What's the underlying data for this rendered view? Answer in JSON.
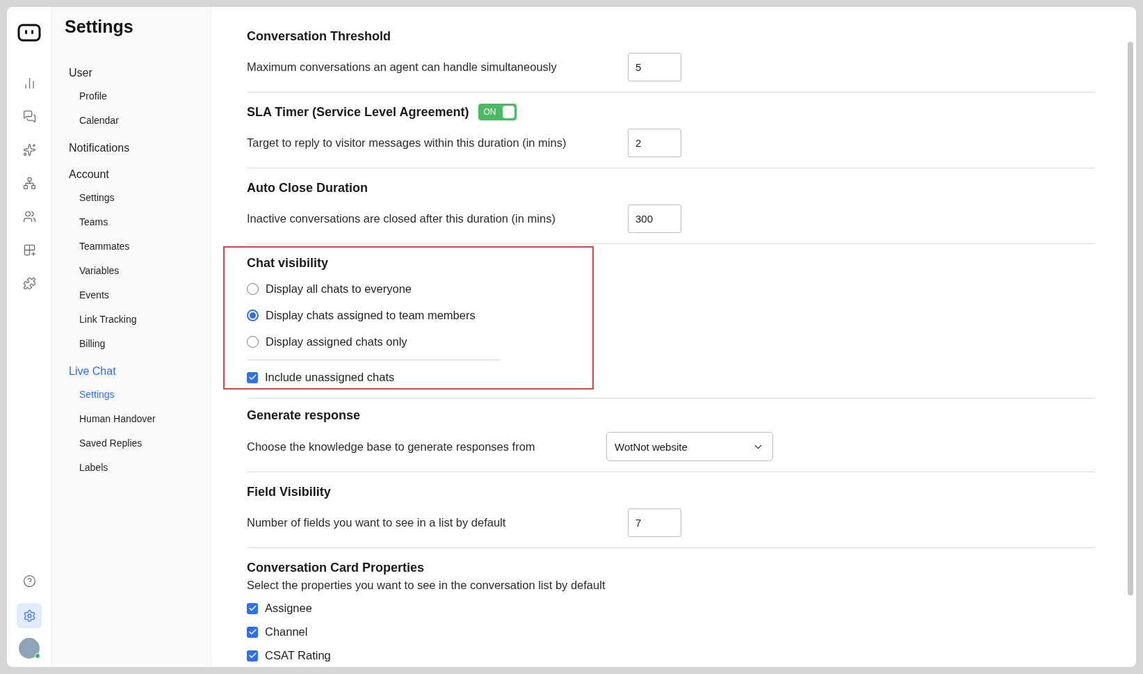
{
  "app": {
    "title": "Settings"
  },
  "rail": {
    "top": [
      {
        "kind": "chart",
        "selected": false
      },
      {
        "kind": "chat",
        "selected": false
      },
      {
        "kind": "sparkle",
        "selected": false
      },
      {
        "kind": "hierarchy",
        "selected": false
      },
      {
        "kind": "users",
        "selected": false
      },
      {
        "kind": "apps",
        "selected": false
      },
      {
        "kind": "puzzle",
        "selected": false
      }
    ],
    "bottom": [
      {
        "kind": "help",
        "selected": false
      },
      {
        "kind": "settings",
        "selected": true
      },
      {
        "kind": "avatar",
        "selected": false,
        "online": true
      }
    ]
  },
  "sidebar": {
    "groups": [
      {
        "label": "User",
        "selected": false,
        "children": [
          {
            "label": "Profile",
            "selected": false
          },
          {
            "label": "Calendar",
            "selected": false
          }
        ]
      },
      {
        "label": "Notifications",
        "selected": false
      },
      {
        "label": "Account",
        "selected": false,
        "children": [
          {
            "label": "Settings",
            "selected": false
          },
          {
            "label": "Teams",
            "selected": false
          },
          {
            "label": "Teammates",
            "selected": false
          },
          {
            "label": "Variables",
            "selected": false
          },
          {
            "label": "Events",
            "selected": false
          },
          {
            "label": "Link Tracking",
            "selected": false
          },
          {
            "label": "Billing",
            "selected": false
          }
        ]
      },
      {
        "label": "Live Chat",
        "selected": true,
        "children": [
          {
            "label": "Settings",
            "selected": true
          },
          {
            "label": "Human Handover",
            "selected": false
          },
          {
            "label": "Saved Replies",
            "selected": false
          },
          {
            "label": "Labels",
            "selected": false
          }
        ]
      }
    ]
  },
  "sections": [
    {
      "kind": "number",
      "title": "Conversation Threshold",
      "description": "Maximum conversations an agent can handle simultaneously",
      "value": "5",
      "highlighted": false
    },
    {
      "kind": "number",
      "title": "SLA Timer (Service Level Agreement)",
      "toggle": {
        "label": "ON",
        "on": true
      },
      "description": "Target to reply to visitor messages within this duration (in mins)",
      "value": "2",
      "highlighted": false
    },
    {
      "kind": "number",
      "title": "Auto Close Duration",
      "description": "Inactive conversations are closed after this duration (in mins)",
      "value": "300",
      "highlighted": false
    },
    {
      "kind": "radio",
      "title": "Chat visibility",
      "highlighted": true,
      "options": [
        {
          "label": "Display all chats to everyone",
          "selected": false
        },
        {
          "label": "Display chats assigned to team members",
          "selected": true
        },
        {
          "label": "Display assigned chats only",
          "selected": false
        }
      ],
      "checkbox": {
        "label": "Include unassigned chats",
        "checked": true
      }
    },
    {
      "kind": "select",
      "title": "Generate response",
      "description": "Choose the knowledge base to generate responses from",
      "value": "WotNot website",
      "highlighted": false
    },
    {
      "kind": "number",
      "title": "Field Visibility",
      "description": "Number of fields you want to see in a list by default",
      "value": "7",
      "highlighted": false
    },
    {
      "kind": "checklist",
      "title": "Conversation Card Properties",
      "description": "Select the properties you want to see in the conversation list by default",
      "highlighted": false,
      "items": [
        {
          "label": "Assignee",
          "checked": true
        },
        {
          "label": "Channel",
          "checked": true
        },
        {
          "label": "CSAT Rating",
          "checked": true
        }
      ]
    }
  ]
}
